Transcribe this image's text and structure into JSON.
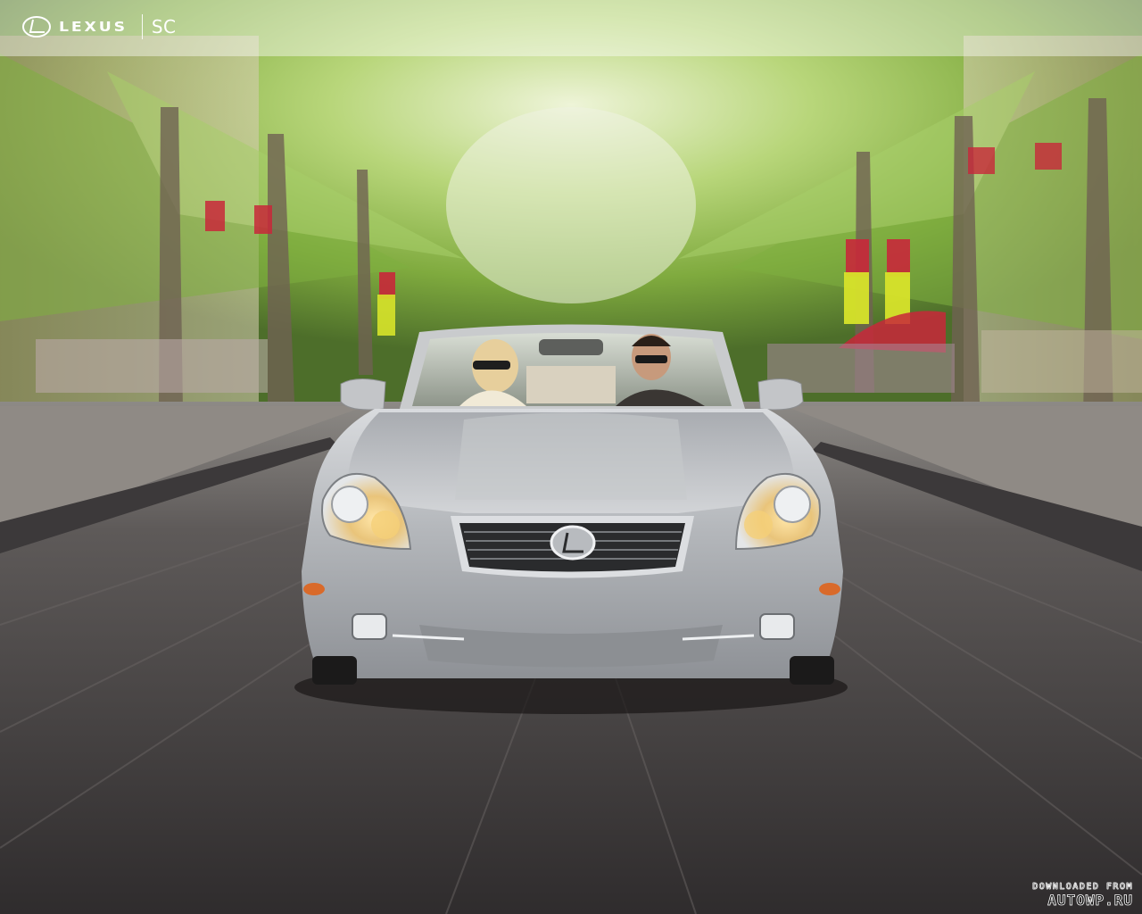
{
  "header": {
    "brand_name": "LEXUS",
    "model_name": "SC"
  },
  "watermark": {
    "line1": "DOWNLOADED FROM",
    "line2": "AUTOWP.RU"
  },
  "colors": {
    "header_band": "#ffffff",
    "car_body": "#b7b9bc",
    "foliage": "#8fbf4a",
    "road": "#4a4647",
    "banner_red": "#c8283a",
    "banner_yellow": "#d7e32a"
  },
  "icons": {
    "brand_emblem": "lexus-emblem-icon"
  }
}
